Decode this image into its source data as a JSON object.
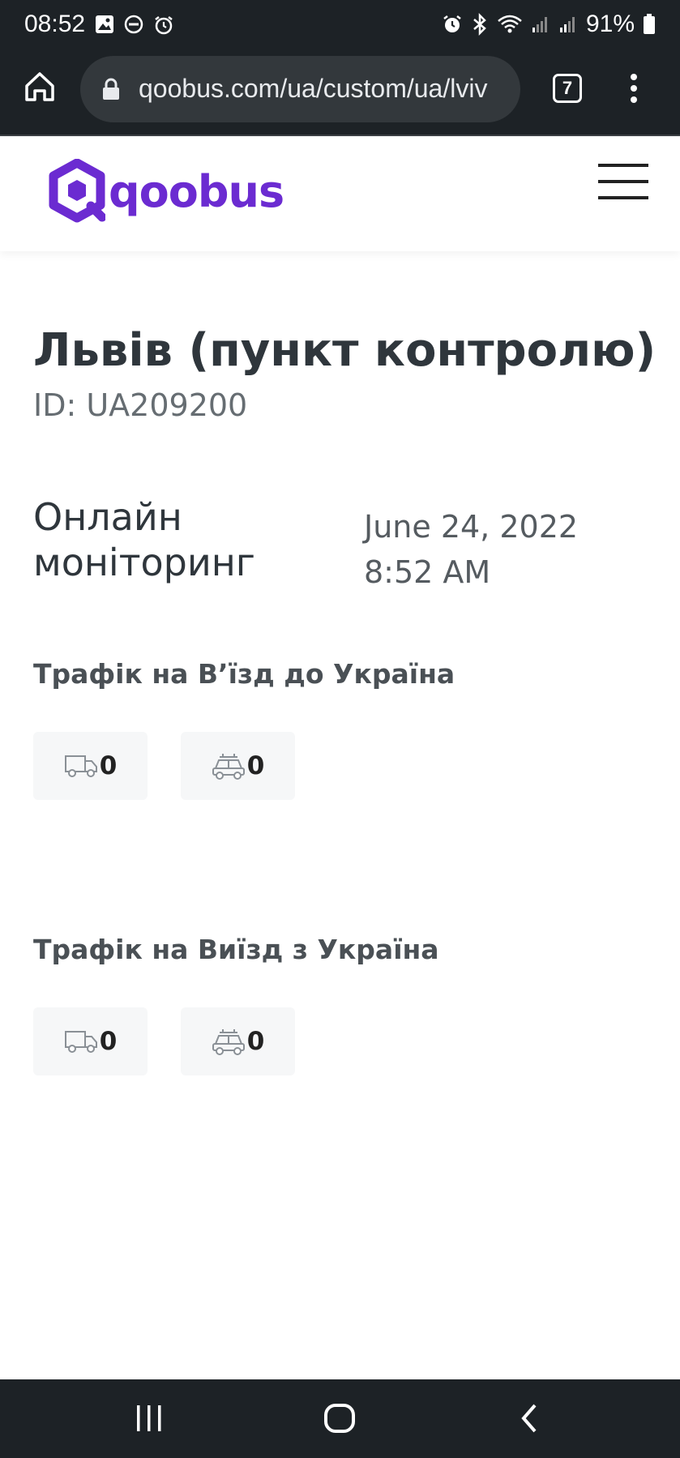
{
  "status_bar": {
    "time": "08:52",
    "battery": "91%",
    "left_icons": [
      "image-icon",
      "dnd-icon",
      "alarm-icon"
    ],
    "right_icons": [
      "alarm-icon",
      "bluetooth-icon",
      "wifi-icon",
      "signal-icon",
      "signal-icon",
      "battery-icon"
    ]
  },
  "browser": {
    "url": "qoobus.com/ua/custom/ua/lviv",
    "tab_count": "7"
  },
  "site": {
    "logo_text": "qoobus",
    "brand_color": "#6b2bd1"
  },
  "page": {
    "title": "Львів (пункт контролю)",
    "id": "ID: UA209200",
    "monitoring_label": "Онлайн моніторинг",
    "date": "June 24, 2022",
    "time": "8:52 AM"
  },
  "traffic": {
    "entry": {
      "title": "Трафік на В’їзд до Україна",
      "trucks": "0",
      "cars": "0"
    },
    "exit": {
      "title": "Трафік на Виїзд з Україна",
      "trucks": "0",
      "cars": "0"
    }
  }
}
